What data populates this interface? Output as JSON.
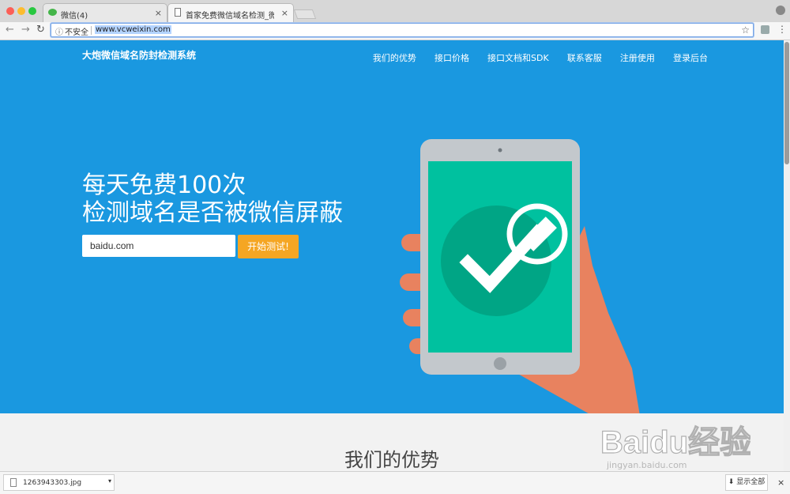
{
  "browser": {
    "tabs": [
      {
        "label": "微信(4)",
        "active": false
      },
      {
        "label": "首家免费微信域名检测_微信域名",
        "active": false
      }
    ],
    "close_glyph": "×",
    "address": {
      "security_label": "不安全",
      "url": "www.vcweixin.com"
    }
  },
  "site": {
    "brand": "大炮微信域名防封检测系统",
    "nav": [
      "我们的优势",
      "接口价格",
      "接口文档和SDK",
      "联系客服",
      "注册使用",
      "登录后台"
    ],
    "headline_line1": "每天免费100次",
    "headline_line2": "检测域名是否被微信屏蔽",
    "domain_input_value": "baidu.com",
    "start_button": "开始测试!",
    "section_title": "我们的优势",
    "colors": {
      "hero_bg": "#1a98e0",
      "button": "#f5a623",
      "screen": "#00c19f"
    }
  },
  "watermark": {
    "text": "Baidu经验",
    "sub": "jingyan.baidu.com"
  },
  "downloads": {
    "item_name": "1263943303.jpg",
    "show_all": "显示全部",
    "close_glyph": "×"
  }
}
